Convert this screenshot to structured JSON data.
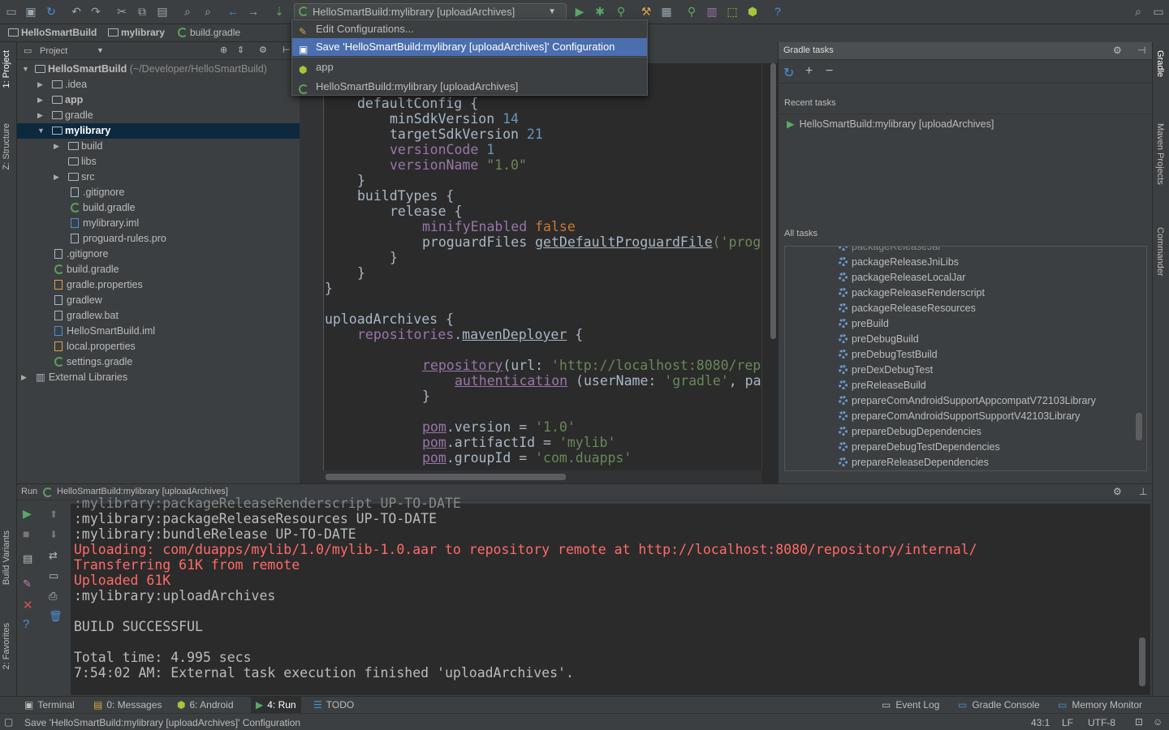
{
  "toolbar": {
    "run_config": "HelloSmartBuild:mylibrary [uploadArchives]"
  },
  "popup": {
    "items": [
      {
        "label": "Edit Configurations..."
      },
      {
        "label": "Save 'HelloSmartBuild:mylibrary [uploadArchives]' Configuration"
      },
      {
        "label": "app"
      },
      {
        "label": "HelloSmartBuild:mylibrary [uploadArchives]"
      }
    ]
  },
  "navbar": {
    "crumbs": [
      "HelloSmartBuild",
      "mylibrary",
      "build.gradle"
    ]
  },
  "left_strip": {
    "tabs": [
      "1: Project",
      "Z: Structure",
      "Build Variants",
      "2: Favorites"
    ]
  },
  "right_strip": {
    "tabs": [
      "Gradle",
      "Maven Projects",
      "Commander"
    ]
  },
  "project": {
    "header": "Project",
    "root_name": "HelloSmartBuild",
    "root_path": "(~/Developer/HelloSmartBuild)",
    "items": [
      ".idea",
      "app",
      "gradle",
      "mylibrary",
      "build",
      "libs",
      "src",
      ".gitignore",
      "build.gradle",
      "mylibrary.iml",
      "proguard-rules.pro",
      ".gitignore",
      "build.gradle",
      "gradle.properties",
      "gradlew",
      "gradlew.bat",
      "HelloSmartBuild.iml",
      "local.properties",
      "settings.gradle",
      "External Libraries"
    ]
  },
  "editor": {
    "lines": [
      "defaultConfig {",
      "minSdkVersion",
      "14",
      "targetSdkVersion",
      "21",
      "versionCode",
      "1",
      "versionName",
      "\"1.0\"",
      "}",
      "buildTypes {",
      "release {",
      "minifyEnabled",
      "false",
      "proguardFiles",
      "getDefaultProguardFile",
      "('prog",
      "}",
      "}",
      "}",
      "uploadArchives {",
      "repositories",
      ".",
      "mavenDeployer",
      " {",
      "repository",
      "(url: ",
      "'http://localhost:8080/rep",
      "authentication",
      " (userName: ",
      "'gradle'",
      ", pa",
      "}",
      "pom",
      ".version = ",
      "'1.0'",
      "pom",
      ".artifactId = ",
      "'mylib'",
      "pom",
      ".groupId = ",
      "'com.duapps'"
    ]
  },
  "gradle": {
    "title": "Gradle tasks",
    "recent_label": "Recent tasks",
    "recent_task": "HelloSmartBuild:mylibrary [uploadArchives]",
    "all_label": "All tasks",
    "tasks": [
      "packageReleaseJniLibs",
      "packageReleaseLocalJar",
      "packageReleaseRenderscript",
      "packageReleaseResources",
      "preBuild",
      "preDebugBuild",
      "preDebugTestBuild",
      "preDexDebugTest",
      "preReleaseBuild",
      "prepareComAndroidSupportAppcompatV72103Library",
      "prepareComAndroidSupportSupportV42103Library",
      "prepareDebugDependencies",
      "prepareDebugTestDependencies",
      "prepareReleaseDependencies"
    ]
  },
  "run": {
    "title_prefix": "Run",
    "title": "HelloSmartBuild:mylibrary [uploadArchives]",
    "console": [
      ":mylibrary:packageReleaseResources UP-TO-DATE",
      ":mylibrary:bundleRelease UP-TO-DATE",
      "Uploading: com/duapps/mylib/1.0/mylib-1.0.aar to repository remote at http://localhost:8080/repository/internal/",
      "Transferring 61K from remote",
      "Uploaded 61K",
      ":mylibrary:uploadArchives",
      "",
      "BUILD SUCCESSFUL",
      "",
      "Total time: 4.995 secs",
      "7:54:02 AM: External task execution finished 'uploadArchives'."
    ]
  },
  "bottom_tabs": {
    "terminal": "Terminal",
    "messages": "0: Messages",
    "android": "6: Android",
    "run": "4: Run",
    "todo": "TODO",
    "event_log": "Event Log",
    "gradle_console": "Gradle Console",
    "memory_monitor": "Memory Monitor"
  },
  "status": {
    "message": "Save 'HelloSmartBuild:mylibrary [uploadArchives]' Configuration",
    "position": "43:1",
    "line_sep": "LF",
    "encoding": "UTF-8"
  },
  "colors": {
    "accent": "#4b6eaf",
    "background": "#3c3f41",
    "editor_bg": "#2b2b2b",
    "keyword": "#cc7832",
    "property": "#9876aa",
    "string": "#6a8759",
    "number": "#6897bb",
    "error_text": "#ff6b68"
  }
}
